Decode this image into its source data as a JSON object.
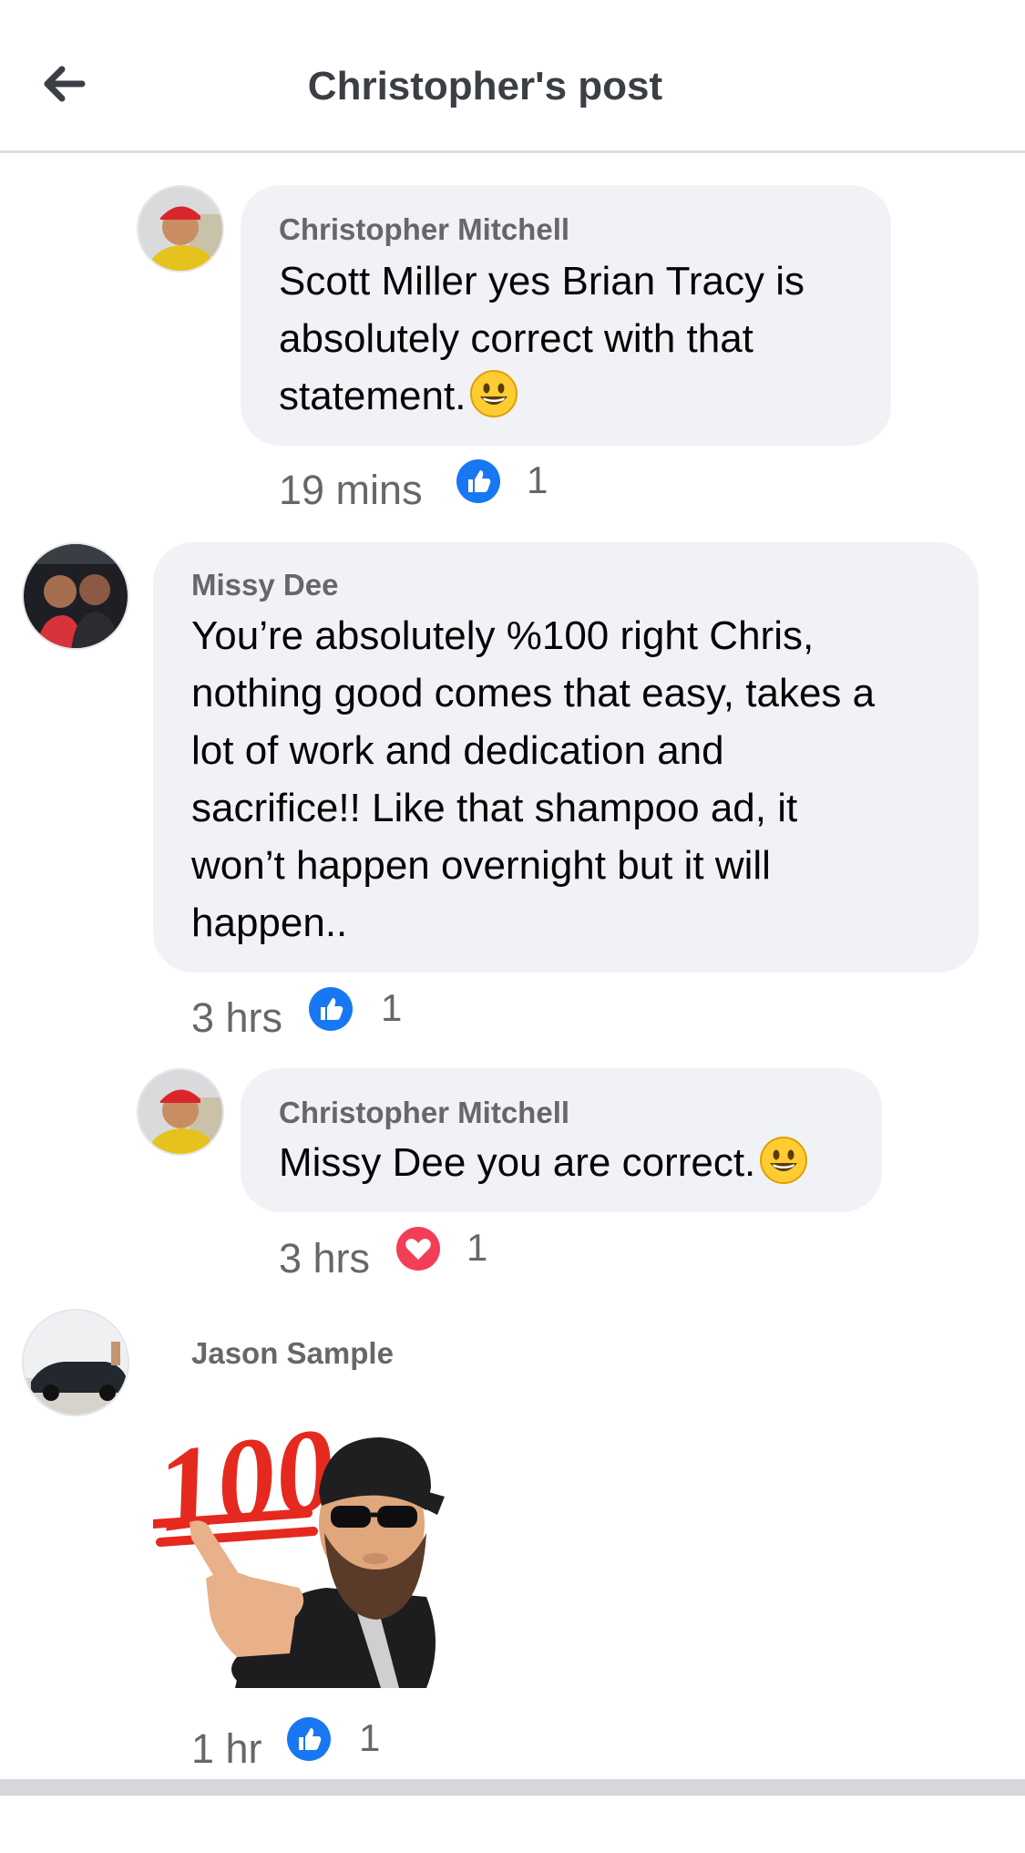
{
  "header": {
    "title": "Christopher's post",
    "back_icon": "back-arrow-icon"
  },
  "comments": [
    {
      "author": "Christopher Mitchell",
      "lines": [
        "Scott Miller yes Brian Tracy is",
        "absolutely correct with that",
        "statement."
      ],
      "emoji": "grinning-face-emoji",
      "time": "19 mins",
      "reaction": "like",
      "reaction_count": "1"
    },
    {
      "author": "Missy Dee",
      "lines": [
        "You’re absolutely %100 right Chris,",
        "nothing good comes that easy, takes a",
        "lot of work and dedication and",
        "sacrifice!! Like that shampoo ad, it",
        "won’t happen overnight but it will",
        "happen.."
      ],
      "time": "3 hrs",
      "reaction": "like",
      "reaction_count": "1"
    },
    {
      "author": "Christopher Mitchell",
      "text": "Missy Dee you are correct.",
      "emoji": "grinning-face-emoji",
      "time": "3 hrs",
      "reaction": "love",
      "reaction_count": "1"
    },
    {
      "author": "Jason Sample",
      "sticker": "100-pointing-avatar-sticker",
      "sticker_text": "100",
      "time": "1 hr",
      "reaction": "like",
      "reaction_count": "1"
    }
  ],
  "colors": {
    "like_blue": "#1877f2",
    "love_red": "#f33e58",
    "bubble_gray": "#f0f2f5",
    "meta_gray": "#65676b"
  }
}
